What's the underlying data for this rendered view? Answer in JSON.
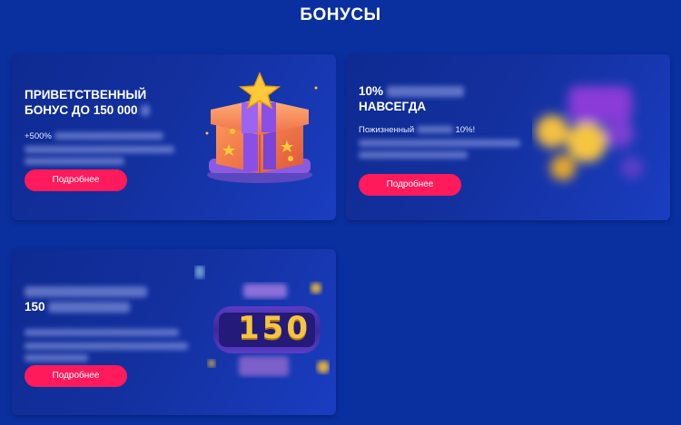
{
  "page": {
    "title": "БОНУСЫ"
  },
  "cards": [
    {
      "title_line1": "ПРИВЕТСТВЕННЫЙ",
      "title_line2": "БОНУС ДО 150 000",
      "desc_visible": "+500%",
      "button": "Подробнее",
      "icon": "gift-box-with-star"
    },
    {
      "title_line1": "10%",
      "title_line2": "НАВСЕГДА",
      "desc_visible_a": "Пожизненный",
      "desc_visible_b": "10%!",
      "button": "Подробнее",
      "icon": "coins-blurred"
    },
    {
      "title_line2": "150",
      "button": "Подробнее",
      "icon": "slot-counter-150",
      "counter": "150"
    }
  ],
  "colors": {
    "background": "#0a2f9f",
    "button": "#ff1a5b",
    "accent_gold": "#f5c542"
  }
}
